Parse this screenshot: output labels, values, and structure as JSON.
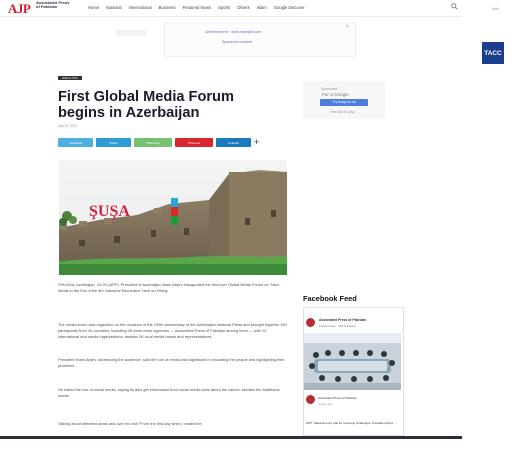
{
  "header": {
    "logo_text": "AJP",
    "site_name_line1": "Associated Press",
    "site_name_line2": "of Pakistan",
    "nav_items": [
      "Home",
      "National",
      "International",
      "Business",
      "Featured News",
      "Sports",
      "Others",
      "Islam",
      "Google Discover"
    ]
  },
  "ad": {
    "line1": "Advertisement · www.example.com",
    "line2": "Sponsored content"
  },
  "right": {
    "top_text": "ddd",
    "tacc_logo": "ТАСС"
  },
  "article": {
    "category": "Editor's Pick",
    "title": "First Global Media Forum begins in Azerbaijan",
    "meta": "July 20, 2022",
    "share": {
      "facebook": "Facebook",
      "twitter": "Twitter",
      "whatsapp": "WhatsApp",
      "pinterest": "Pinterest",
      "linkedin": "LinkedIn"
    },
    "image_text": "ŞUŞA",
    "paragraphs": [
      "SHUSHA, Azerbaijan, Jul 20 (APP): President of Azerbaijan Ilham Aliyev inaugurated the first-ever Global Media Forum on “New Media in the Era of the 4th Industrial Revolution” here on Friday.",
      "The media forum was organized on the occasion of the 150th anniversary of the Azerbaijani National Press and brought together 150 participants from 49 countries, including 28 news news agencies — Associated Press of Pakistan among them — with 12 international and media organizations, besides 50 local media heads and representatives.",
      "President Ilham Aliyev, addressing the audience, said the role of media was significant in educating the people and highlighting their problems.",
      "He hailed the role of social media, saying its also get information from social media tools about the values, besides the traditional media.",
      "Talking about liberated areas and over his visit “From the first day when I visited the"
    ]
  },
  "sidebar": {
    "line1": "Sponsored",
    "line2": "For a Google",
    "button": "Try today for all",
    "line3": "Free trial 30 days"
  },
  "facebook_feed": {
    "title": "Facebook Feed",
    "page_name": "Associated Press of Pakistan",
    "follow": "Follow Page · 44K followers",
    "post_author": "Associated Press of Pakistan",
    "post_date": "3 days ago",
    "post_text": "APP: National unity vital for resolving challenges, President Aliyev ..."
  }
}
